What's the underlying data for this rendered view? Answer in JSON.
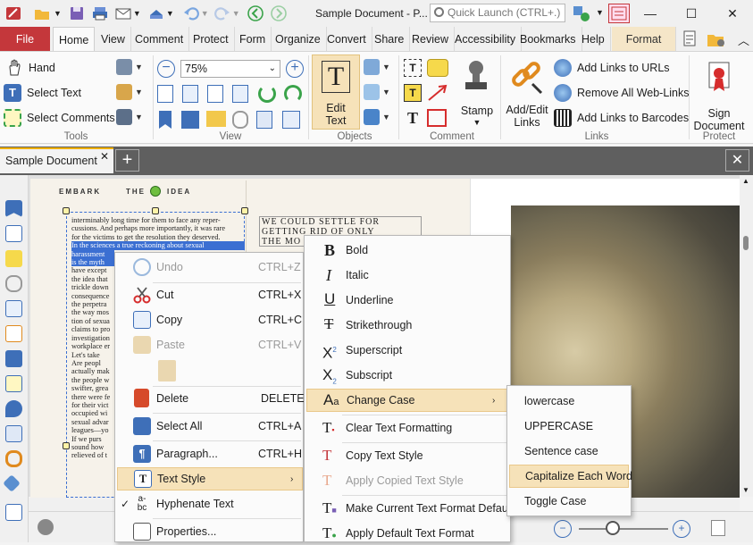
{
  "titlebar": {
    "document_title": "Sample Document - P...",
    "quick_launch_placeholder": "Quick Launch (CTRL+.)"
  },
  "ribbon": {
    "tabs": [
      {
        "label": "File"
      },
      {
        "label": "Home"
      },
      {
        "label": "View"
      },
      {
        "label": "Comment"
      },
      {
        "label": "Protect"
      },
      {
        "label": "Form"
      },
      {
        "label": "Organize"
      },
      {
        "label": "Convert"
      },
      {
        "label": "Share"
      },
      {
        "label": "Review"
      },
      {
        "label": "Accessibility"
      },
      {
        "label": "Bookmarks"
      },
      {
        "label": "Help"
      },
      {
        "label": "Format"
      }
    ],
    "tools": {
      "hand": "Hand",
      "select_text": "Select Text",
      "select_comments": "Select Comments",
      "group": "Tools"
    },
    "view": {
      "zoom_value": "75%",
      "group": "View"
    },
    "objects": {
      "edit_text_line1": "Edit",
      "edit_text_line2": "Text",
      "group": "Objects"
    },
    "comment": {
      "stamp": "Stamp",
      "group": "Comment"
    },
    "links": {
      "add_edit_line1": "Add/Edit",
      "add_edit_line2": "Links",
      "add_links_urls": "Add Links to URLs",
      "remove_web_links": "Remove All Web-Links",
      "add_links_barcodes": "Add Links to Barcodes",
      "group": "Links"
    },
    "protect": {
      "sign_line1": "Sign",
      "sign_line2": "Document",
      "group": "Protect"
    }
  },
  "doctab": {
    "label": "Sample Document"
  },
  "page": {
    "header_left": "EMBARK",
    "header_right": "THE",
    "header_idea": "IDEA",
    "col_lines": [
      "interminably long time for them to face any reper-",
      "cussions. And perhaps more importantly, it was rare",
      "for the victims to get the resolution they deserved.",
      "    In the sciences a true reckoning about sexual",
      "harassment",
      "is the myth",
      "have except",
      "the idea that",
      "trickle down",
      "consequence",
      "the perpetra",
      "the way mos",
      "tion of sexua",
      "claims to pro",
      "investigation",
      "workplace er",
      "    Let's take",
      "    Are peopl",
      "actually mak",
      "the people w",
      "swifter, grea",
      "there were fe",
      "for their vict",
      "occupied wi",
      "sexual advar",
      "leagues—yo",
      "    If we purs",
      "sound how",
      "relieved of t"
    ],
    "right_col_lines": [
      "WE COULD SETTLE FOR",
      "GETTING RID OF ONLY",
      "THE MO"
    ]
  },
  "context_menu": {
    "items": [
      {
        "label": "Undo",
        "shortcut": "CTRL+Z",
        "disabled": true
      },
      {
        "label": "Cut",
        "shortcut": "CTRL+X"
      },
      {
        "label": "Copy",
        "shortcut": "CTRL+C"
      },
      {
        "label": "Paste",
        "shortcut": "CTRL+V",
        "disabled": true
      },
      {
        "label": "Delete",
        "shortcut": "DELETE"
      },
      {
        "label": "Select All",
        "shortcut": "CTRL+A"
      },
      {
        "label": "Paragraph...",
        "shortcut": "CTRL+H"
      },
      {
        "label": "Text Style",
        "shortcut": ""
      },
      {
        "label": "Hyphenate Text",
        "shortcut": ""
      },
      {
        "label": "Properties...",
        "shortcut": ""
      }
    ]
  },
  "text_style_menu": {
    "items": [
      {
        "label": "Bold"
      },
      {
        "label": "Italic"
      },
      {
        "label": "Underline"
      },
      {
        "label": "Strikethrough"
      },
      {
        "label": "Superscript"
      },
      {
        "label": "Subscript"
      },
      {
        "label": "Change Case"
      },
      {
        "label": "Clear Text Formatting"
      },
      {
        "label": "Copy Text Style"
      },
      {
        "label": "Apply Copied Text Style",
        "disabled": true
      },
      {
        "label": "Make Current Text Format Default"
      },
      {
        "label": "Apply Default Text Format"
      }
    ]
  },
  "change_case_menu": {
    "items": [
      {
        "label": "lowercase"
      },
      {
        "label": "UPPERCASE"
      },
      {
        "label": "Sentence case"
      },
      {
        "label": "Capitalize Each Word"
      },
      {
        "label": "Toggle Case"
      }
    ]
  },
  "colors": {
    "accent": "#c4373b",
    "menu_hover": "#f6e2b9",
    "selection": "#3b6fd2",
    "doc_tab_strip": "#5f5f5f"
  }
}
